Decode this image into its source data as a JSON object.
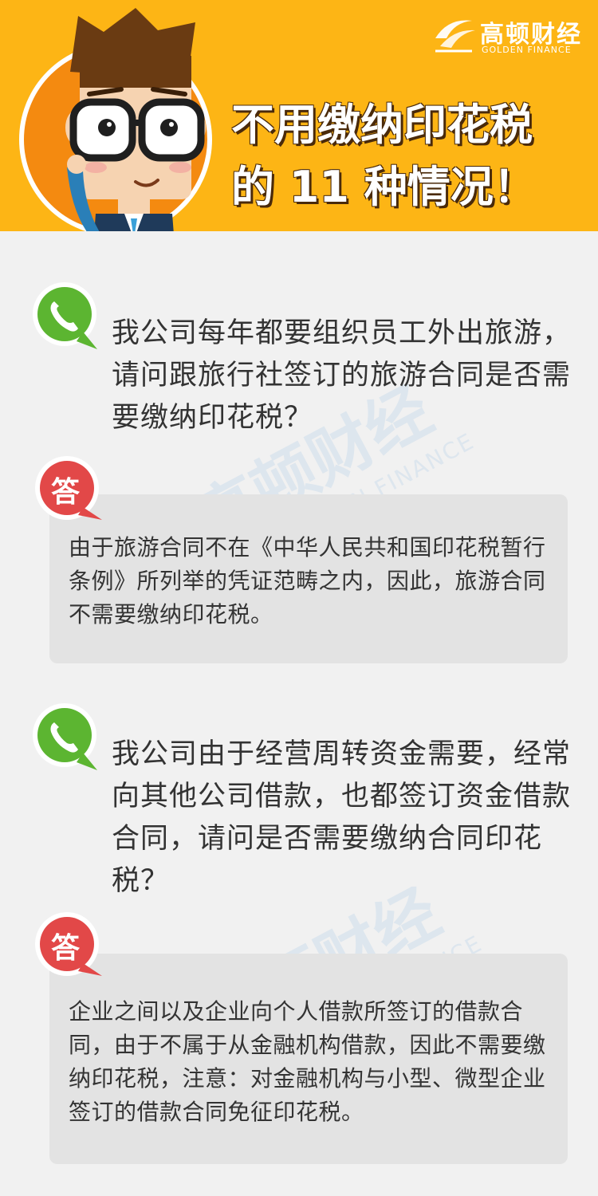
{
  "header": {
    "brand": "高顿财经",
    "brand_en": "GOLDEN FINANCE",
    "title_line1": "不用缴纳印花税",
    "title_line2": "的 11 种情况！"
  },
  "watermark": {
    "cn": "高顿财经",
    "en": "GOLDEN FINANCE"
  },
  "qa": [
    {
      "question": "我公司每年都要组织员工外出旅游，请问跟旅行社签订的旅游合同是否需要缴纳印花税？",
      "answer_label": "答",
      "answer": "由于旅游合同不在《中华人民共和国印花税暂行条例》所列举的凭证范畴之内，因此，旅游合同不需要缴纳印花税。"
    },
    {
      "question": "我公司由于经营周转资金需要，经常向其他公司借款，也都签订资金借款合同，请问是否需要缴纳合同印花税？",
      "answer_label": "答",
      "answer": "企业之间以及企业向个人借款所签订的借款合同，由于不属于从金融机构借款，因此不需要缴纳印花税，注意：对金融机构与小型、微型企业签订的借款合同免征印花税。"
    }
  ],
  "colors": {
    "header_bg": "#fdb515",
    "phone_green": "#5cb531",
    "answer_red": "#e24848",
    "answer_box": "#e3e3e3"
  },
  "icons": {
    "phone": "phone-icon",
    "answer": "answer-badge-icon",
    "logo": "golden-finance-logo-icon",
    "mascot": "cartoon-man-with-glasses"
  }
}
